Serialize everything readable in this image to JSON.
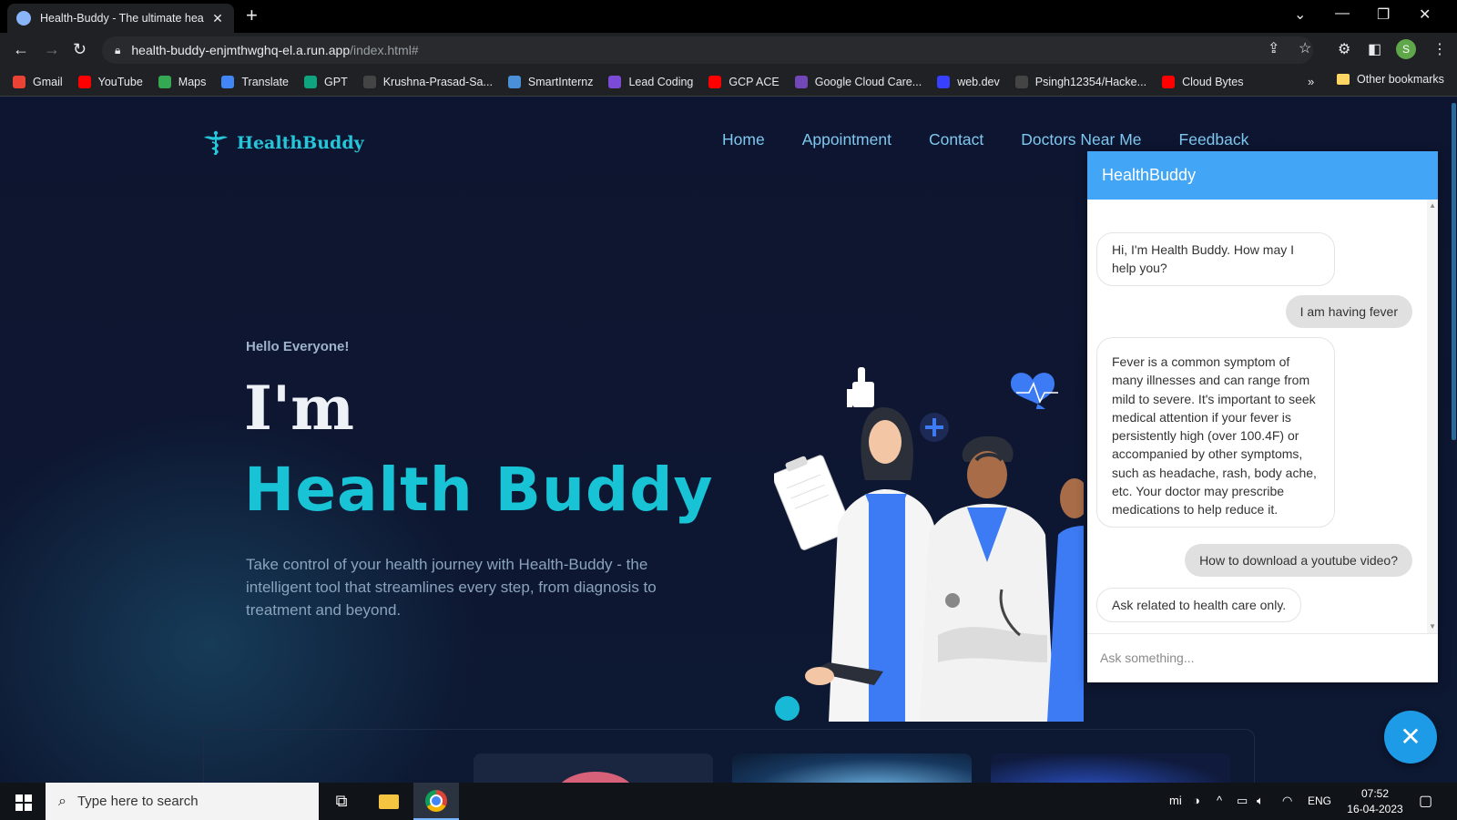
{
  "browser": {
    "tab_title": "Health-Buddy - The ultimate hea",
    "url_host": "health-buddy-enjmthwghq-el.a.run.app",
    "url_path": "/index.html#",
    "profile_initial": "S",
    "bookmarks": [
      {
        "label": "Gmail",
        "icon": "gmail-icon",
        "color": "#ea4335"
      },
      {
        "label": "YouTube",
        "icon": "youtube-icon",
        "color": "#ff0000"
      },
      {
        "label": "Maps",
        "icon": "maps-icon",
        "color": "#34a853"
      },
      {
        "label": "Translate",
        "icon": "translate-icon",
        "color": "#4285f4"
      },
      {
        "label": "GPT",
        "icon": "gpt-icon",
        "color": "#10a37f"
      },
      {
        "label": "Krushna-Prasad-Sa...",
        "icon": "github-icon",
        "color": "#444444"
      },
      {
        "label": "SmartInternz",
        "icon": "smartinternz-icon",
        "color": "#4a90d9"
      },
      {
        "label": "Lead Coding",
        "icon": "leadcoding-icon",
        "color": "#7b4bd8"
      },
      {
        "label": "GCP ACE",
        "icon": "youtube-icon",
        "color": "#ff0000"
      },
      {
        "label": "Google Cloud Care...",
        "icon": "google-forms-icon",
        "color": "#7248b9"
      },
      {
        "label": "web.dev",
        "icon": "webdev-icon",
        "color": "#3740ff"
      },
      {
        "label": "Psingh12354/Hacke...",
        "icon": "github-icon",
        "color": "#444444"
      },
      {
        "label": "Cloud Bytes",
        "icon": "youtube-icon",
        "color": "#ff0000"
      }
    ],
    "more_bookmarks": "»",
    "other_bookmarks": "Other bookmarks"
  },
  "site": {
    "brand": "HealthBuddy",
    "nav": [
      "Home",
      "Appointment",
      "Contact",
      "Doctors Near Me",
      "Feedback"
    ],
    "hero": {
      "greeting": "Hello Everyone!",
      "line1": "I'm",
      "line2": "Health Buddy",
      "description": "Take control of your health journey with Health-Buddy - the intelligent tool that streamlines every step, from diagnosis to treatment and beyond."
    },
    "colors": {
      "accent": "#18c3d6",
      "background": "#0d1630",
      "chat_header": "#42a5f5"
    }
  },
  "chat": {
    "title": "HealthBuddy",
    "messages": [
      {
        "from": "bot",
        "text": "Hi, I'm Health Buddy. How may I help you?"
      },
      {
        "from": "user",
        "text": "I am having fever"
      },
      {
        "from": "bot",
        "text": "Fever is a common symptom of many illnesses and can range from mild to severe. It's important to seek medical attention if your fever is persistently high (over 100.4F) or accompanied by other symptoms, such as headache, rash, body ache, etc. Your doctor may prescribe medications to help reduce it."
      },
      {
        "from": "user",
        "text": "How to download a youtube video?"
      },
      {
        "from": "bot",
        "text": "Ask related to health care only."
      }
    ],
    "input_placeholder": "Ask something...",
    "close_icon": "close-icon"
  },
  "taskbar": {
    "search_placeholder": "Type here to search",
    "language": "ENG",
    "time": "07:52",
    "date": "16-04-2023"
  }
}
